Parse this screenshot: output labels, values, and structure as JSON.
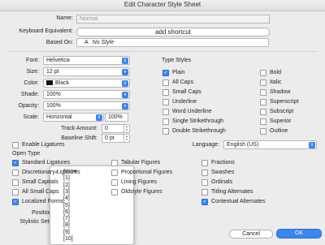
{
  "window": {
    "title": "Edit Character Style Sheet"
  },
  "general": {
    "name_label": "Name:",
    "name_value": "Normal",
    "keyboard_label": "Keyboard Equivalent:",
    "add_shortcut": "add shortcut",
    "based_on_label": "Based On:",
    "based_on_value": "No Style",
    "based_on_icon": "A"
  },
  "char": {
    "font_label": "Font:",
    "font_value": "Helvetica",
    "size_label": "Size:",
    "size_value": "12 pt",
    "color_label": "Color:",
    "color_value": "Black",
    "color_swatch": "#111111",
    "shade_label": "Shade:",
    "shade_value": "100%",
    "opacity_label": "Opacity:",
    "opacity_value": "100%",
    "scale_label": "Scale:",
    "scale_mode": "Horizontal",
    "scale_value": "100%",
    "track_label": "Track Amount:",
    "track_value": "0",
    "baseline_label": "Baseline Shift:",
    "baseline_value": "0 pt"
  },
  "type_styles": {
    "heading": "Type Styles",
    "left": [
      {
        "label": "Plain",
        "checked": true
      },
      {
        "label": "All Caps",
        "checked": false
      },
      {
        "label": "Small Caps",
        "checked": false
      },
      {
        "label": "Underline",
        "checked": false
      },
      {
        "label": "Word Underline",
        "checked": false
      },
      {
        "label": "Single Strikethrough",
        "checked": false
      },
      {
        "label": "Double Strikethrough",
        "checked": false
      }
    ],
    "right": [
      {
        "label": "Bold",
        "checked": false
      },
      {
        "label": "Italic",
        "checked": false
      },
      {
        "label": "Shadow",
        "checked": false
      },
      {
        "label": "Superscript",
        "checked": false
      },
      {
        "label": "Subscript",
        "checked": false
      },
      {
        "label": "Superior",
        "checked": false
      },
      {
        "label": "Outline",
        "checked": false
      }
    ]
  },
  "ligatures": {
    "label": "Enable Ligatures",
    "checked": false
  },
  "language": {
    "label": "Language:",
    "value": "English (US)"
  },
  "opentype": {
    "heading": "Open Type",
    "col1": [
      {
        "label": "Standard Ligatures",
        "checked": true
      },
      {
        "label": "Discretionary Ligatures",
        "checked": false
      },
      {
        "label": "Small Capitals",
        "checked": false
      },
      {
        "label": "All Small Caps",
        "checked": false
      },
      {
        "label": "Localized Forms",
        "checked": true
      }
    ],
    "col2": [
      {
        "label": "Tabular Figures",
        "checked": false
      },
      {
        "label": "Proportional Figures",
        "checked": false
      },
      {
        "label": "Lining Figures",
        "checked": false
      },
      {
        "label": "Oldstyle Figures",
        "checked": false
      }
    ],
    "col3": [
      {
        "label": "Fractions",
        "checked": false
      },
      {
        "label": "Swashes",
        "checked": false
      },
      {
        "label": "Ordinals",
        "checked": false
      },
      {
        "label": "Titling Alternates",
        "checked": false
      },
      {
        "label": "Contextual Alternates",
        "checked": true
      }
    ],
    "position_label": "Position:",
    "stylistic_label": "Stylistic Sets:"
  },
  "dropdown": {
    "selected": "None",
    "items": [
      "None",
      "[1]",
      "[2]",
      "[3]",
      "[4]",
      "[5]",
      "[6]",
      "[7]",
      "[8]",
      "[9]",
      "[10]"
    ]
  },
  "buttons": {
    "cancel": "Cancel",
    "ok": "OK"
  }
}
